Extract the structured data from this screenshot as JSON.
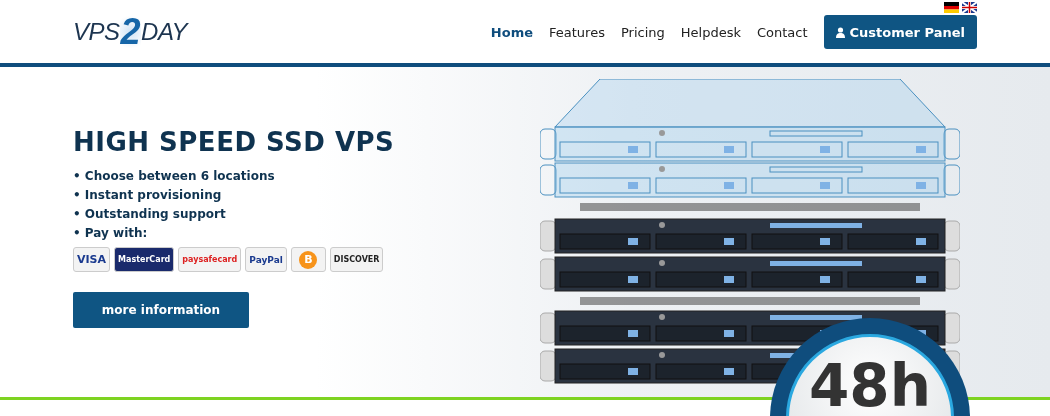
{
  "header": {
    "logo": {
      "parts": [
        "VPS",
        "2",
        "DAY"
      ]
    },
    "nav": [
      {
        "label": "Home",
        "selected": true
      },
      {
        "label": "Features",
        "selected": false
      },
      {
        "label": "Pricing",
        "selected": false
      },
      {
        "label": "Helpdesk",
        "selected": false
      },
      {
        "label": "Contact",
        "selected": false
      }
    ],
    "customer_panel_button": "Customer Panel"
  },
  "hero": {
    "title": "HIGH SPEED SSD VPS",
    "bullets": [
      "• Choose between 6 locations",
      "• Instant provisioning",
      "• Outstanding support",
      "• Pay with:"
    ],
    "payment_methods": [
      {
        "kind": "visa",
        "label": "VISA"
      },
      {
        "kind": "mastercard",
        "label": "MasterCard"
      },
      {
        "kind": "paysafecard",
        "label": "paysafecard"
      },
      {
        "kind": "paypal",
        "label": "PayPal"
      },
      {
        "kind": "bitcoin",
        "label": "B"
      },
      {
        "kind": "discover",
        "label": "DISCOVER"
      }
    ],
    "button": "more information",
    "badge": "48h"
  }
}
